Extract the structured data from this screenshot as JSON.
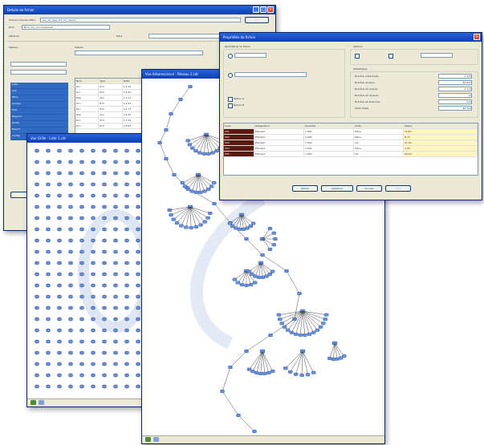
{
  "windows": {
    "details": {
      "title": "Details de fichier",
      "path_label": "Chemin d'accès (URL)",
      "path_value": "fax_ref_mes_old_cdr_report",
      "name_label": "Nom",
      "name_value": "Nom_doc_document.lsb",
      "attrs_label": "Attributs",
      "table_label": "Tableau",
      "filters_label": "Filtre",
      "tabs_label": "Détails",
      "sidebar_items": [
        "Liste",
        "Vue",
        "Filtre",
        "Groupe",
        "Trier",
        "Rapport",
        "Sortie",
        "Export",
        "Config"
      ],
      "columns": [
        "Nom",
        "Type",
        "Taille"
      ],
      "rows": [
        [
          "Doc",
          "fich",
          "1.1.32"
        ],
        [
          "Doc",
          "fich",
          "1.2.45"
        ],
        [
          "Rep",
          "dos",
          "1.3.11"
        ],
        [
          "Doc",
          "fich",
          "1.4.02"
        ],
        [
          "Doc",
          "fich",
          "1.5.77"
        ],
        [
          "Rep",
          "dos",
          "1.6.20"
        ],
        [
          "Doc",
          "fich",
          "1.7.09"
        ],
        [
          "Doc",
          "fich",
          "1.8.64"
        ]
      ]
    },
    "grid_window": {
      "title": "Vue Grille - Liste 1.cdr"
    },
    "tree_window": {
      "title": "Vue Arborescence : Réseau 1.cdr"
    },
    "properties": {
      "title": "Propriétés du fichier",
      "section_general": "Paramètres du fichier",
      "section_options": "Options",
      "section_stats": "Statistiques",
      "option_a": "Option A",
      "option_b": "Option B",
      "stats_labels": [
        "Nombre d'éléments",
        "Nombre de liens",
        "Nombre de noeuds",
        "Nombre de niveaux",
        "Nombre de branches",
        "Taille totale"
      ],
      "stats_values": [
        "1 423",
        "26 807",
        "3 112",
        "12",
        "214",
        "48 352"
      ],
      "table_columns": [
        "Code",
        "Désignation",
        "Quantité",
        "Unité",
        "Valeur"
      ],
      "table_rows": [
        [
          "001",
          "Elément",
          "1.000",
          "Pièce",
          "12.50"
        ],
        [
          "002",
          "Elément",
          "2.000",
          "Pièce",
          "8.75"
        ],
        [
          "003",
          "Elément",
          "1.500",
          "Lot",
          "21.00"
        ],
        [
          "004",
          "Elément",
          "3.000",
          "Pièce",
          "4.20"
        ],
        [
          "005",
          "Elément",
          "1.000",
          "Lot",
          "16.40"
        ]
      ],
      "buttons": {
        "ok": "Valider",
        "apply": "Appliquer",
        "cancel": "Annuler",
        "help": "Aide"
      }
    }
  },
  "colors": {
    "titlebar": "#0b3fb8",
    "selection": "#316ac5",
    "node": "#6b8fd6",
    "accent_dark": "#5a1a12",
    "highlight_yellow": "#fff6c0"
  }
}
